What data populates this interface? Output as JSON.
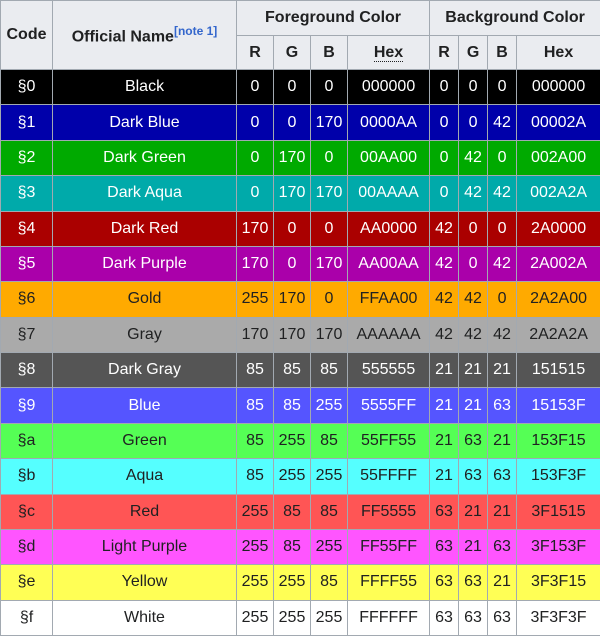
{
  "header": {
    "code": "Code",
    "official_name": "Official Name",
    "note_ref": "[note 1]",
    "foreground": "Foreground Color",
    "background": "Background Color",
    "r": "R",
    "g": "G",
    "b": "B",
    "hex": "Hex"
  },
  "rows": [
    {
      "code": "§0",
      "name": "Black",
      "fr": "0",
      "fg": "0",
      "fb": "0",
      "fhex": "000000",
      "br": "0",
      "bg": "0",
      "bb": "0",
      "bhex": "000000",
      "color": "#000000",
      "text": "#ffffff"
    },
    {
      "code": "§1",
      "name": "Dark Blue",
      "fr": "0",
      "fg": "0",
      "fb": "170",
      "fhex": "0000AA",
      "br": "0",
      "bg": "0",
      "bb": "42",
      "bhex": "00002A",
      "color": "#0000aa",
      "text": "#ffffff"
    },
    {
      "code": "§2",
      "name": "Dark Green",
      "fr": "0",
      "fg": "170",
      "fb": "0",
      "fhex": "00AA00",
      "br": "0",
      "bg": "42",
      "bb": "0",
      "bhex": "002A00",
      "color": "#00aa00",
      "text": "#ffffff"
    },
    {
      "code": "§3",
      "name": "Dark Aqua",
      "fr": "0",
      "fg": "170",
      "fb": "170",
      "fhex": "00AAAA",
      "br": "0",
      "bg": "42",
      "bb": "42",
      "bhex": "002A2A",
      "color": "#00aaaa",
      "text": "#ffffff"
    },
    {
      "code": "§4",
      "name": "Dark Red",
      "fr": "170",
      "fg": "0",
      "fb": "0",
      "fhex": "AA0000",
      "br": "42",
      "bg": "0",
      "bb": "0",
      "bhex": "2A0000",
      "color": "#aa0000",
      "text": "#ffffff"
    },
    {
      "code": "§5",
      "name": "Dark Purple",
      "fr": "170",
      "fg": "0",
      "fb": "170",
      "fhex": "AA00AA",
      "br": "42",
      "bg": "0",
      "bb": "42",
      "bhex": "2A002A",
      "color": "#aa00aa",
      "text": "#ffffff"
    },
    {
      "code": "§6",
      "name": "Gold",
      "fr": "255",
      "fg": "170",
      "fb": "0",
      "fhex": "FFAA00",
      "br": "42",
      "bg": "42",
      "bb": "0",
      "bhex": "2A2A00",
      "color": "#ffaa00",
      "text": "#202122"
    },
    {
      "code": "§7",
      "name": "Gray",
      "fr": "170",
      "fg": "170",
      "fb": "170",
      "fhex": "AAAAAA",
      "br": "42",
      "bg": "42",
      "bb": "42",
      "bhex": "2A2A2A",
      "color": "#aaaaaa",
      "text": "#202122"
    },
    {
      "code": "§8",
      "name": "Dark Gray",
      "fr": "85",
      "fg": "85",
      "fb": "85",
      "fhex": "555555",
      "br": "21",
      "bg": "21",
      "bb": "21",
      "bhex": "151515",
      "color": "#555555",
      "text": "#ffffff"
    },
    {
      "code": "§9",
      "name": "Blue",
      "fr": "85",
      "fg": "85",
      "fb": "255",
      "fhex": "5555FF",
      "br": "21",
      "bg": "21",
      "bb": "63",
      "bhex": "15153F",
      "color": "#5555ff",
      "text": "#ffffff"
    },
    {
      "code": "§a",
      "name": "Green",
      "fr": "85",
      "fg": "255",
      "fb": "85",
      "fhex": "55FF55",
      "br": "21",
      "bg": "63",
      "bb": "21",
      "bhex": "153F15",
      "color": "#55ff55",
      "text": "#202122"
    },
    {
      "code": "§b",
      "name": "Aqua",
      "fr": "85",
      "fg": "255",
      "fb": "255",
      "fhex": "55FFFF",
      "br": "21",
      "bg": "63",
      "bb": "63",
      "bhex": "153F3F",
      "color": "#55ffff",
      "text": "#202122"
    },
    {
      "code": "§c",
      "name": "Red",
      "fr": "255",
      "fg": "85",
      "fb": "85",
      "fhex": "FF5555",
      "br": "63",
      "bg": "21",
      "bb": "21",
      "bhex": "3F1515",
      "color": "#ff5555",
      "text": "#202122"
    },
    {
      "code": "§d",
      "name": "Light Purple",
      "fr": "255",
      "fg": "85",
      "fb": "255",
      "fhex": "FF55FF",
      "br": "63",
      "bg": "21",
      "bb": "63",
      "bhex": "3F153F",
      "color": "#ff55ff",
      "text": "#202122"
    },
    {
      "code": "§e",
      "name": "Yellow",
      "fr": "255",
      "fg": "255",
      "fb": "85",
      "fhex": "FFFF55",
      "br": "63",
      "bg": "63",
      "bb": "21",
      "bhex": "3F3F15",
      "color": "#ffff55",
      "text": "#202122"
    },
    {
      "code": "§f",
      "name": "White",
      "fr": "255",
      "fg": "255",
      "fb": "255",
      "fhex": "FFFFFF",
      "br": "63",
      "bg": "63",
      "bb": "63",
      "bhex": "3F3F3F",
      "color": "#ffffff",
      "text": "#202122"
    }
  ]
}
